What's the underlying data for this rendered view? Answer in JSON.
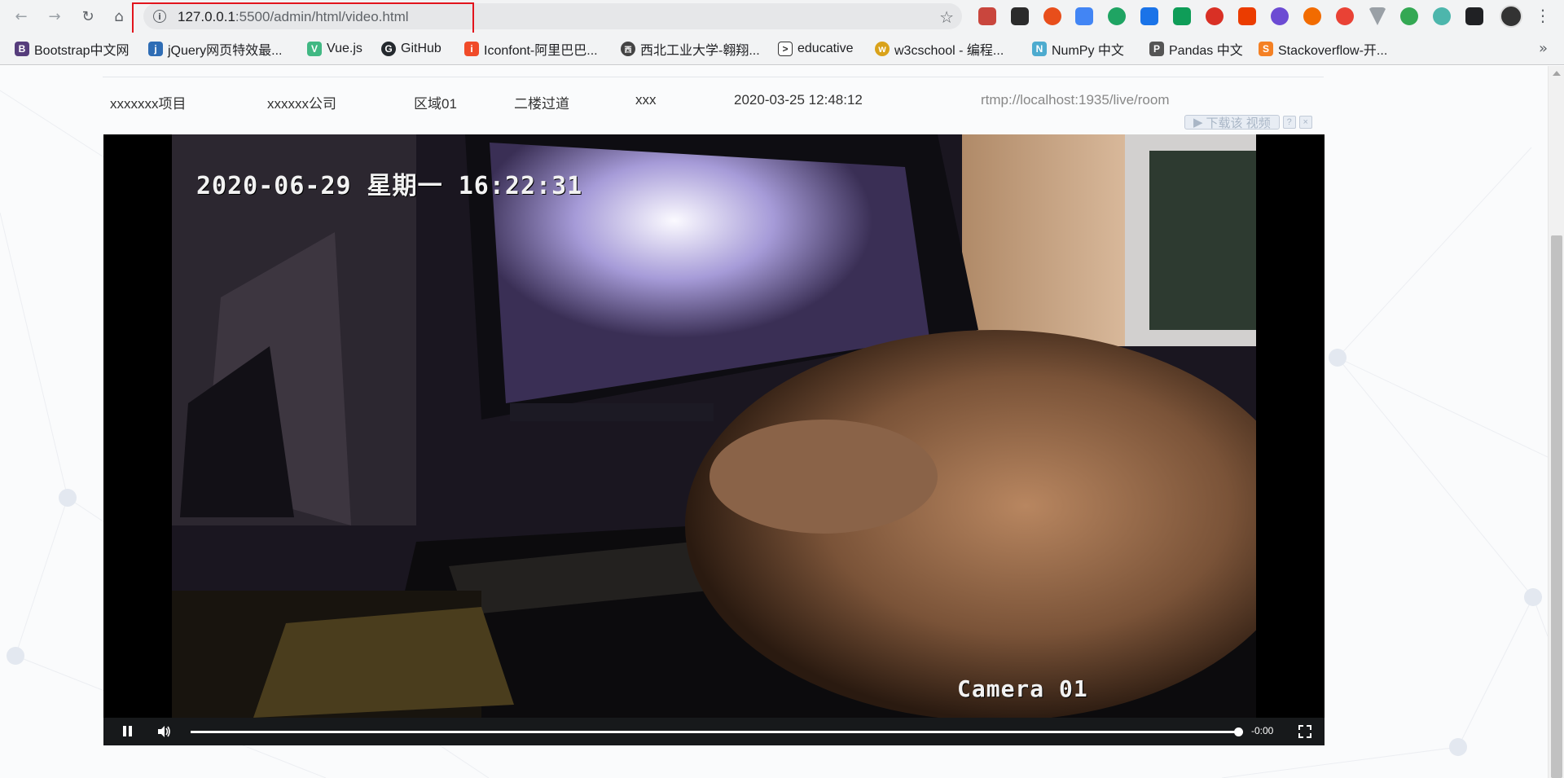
{
  "browser": {
    "url_host": "127.0.0.1",
    "url_path": ":5500/admin/html/video.html",
    "bookmarks": [
      {
        "label": "Bootstrap中文网",
        "icon": "bootstrap-icon",
        "color": "#563d7c",
        "glyph": "B"
      },
      {
        "label": "jQuery网页特效最...",
        "icon": "jquery-icon",
        "color": "#2f6db5",
        "glyph": "j"
      },
      {
        "label": "Vue.js",
        "icon": "vue-icon",
        "color": "#41b883",
        "glyph": "V"
      },
      {
        "label": "GitHub",
        "icon": "github-icon",
        "color": "#24292e",
        "glyph": "G"
      },
      {
        "label": "Iconfont-阿里巴巴...",
        "icon": "iconfont-icon",
        "color": "#f04b29",
        "glyph": "i"
      },
      {
        "label": "西北工业大学-翱翔...",
        "icon": "nwpu-icon",
        "color": "#444444",
        "glyph": "西"
      },
      {
        "label": "educative",
        "icon": "educative-icon",
        "color": "#333333",
        "glyph": ">"
      },
      {
        "label": "w3cschool - 编程...",
        "icon": "w3cschool-icon",
        "color": "#d9a21a",
        "glyph": "w"
      },
      {
        "label": "NumPy 中文",
        "icon": "numpy-icon",
        "color": "#4dabcf",
        "glyph": "N"
      },
      {
        "label": "Pandas 中文",
        "icon": "pandas-icon",
        "color": "#555555",
        "glyph": "P"
      },
      {
        "label": "Stackoverflow-开...",
        "icon": "stackoverflow-icon",
        "color": "#f48024",
        "glyph": "S"
      }
    ]
  },
  "row": {
    "project": "xxxxxxx项目",
    "company": "xxxxxx公司",
    "area": "区域01",
    "location": "二楼过道",
    "name": "xxx",
    "datetime": "2020-03-25 12:48:12",
    "stream_url": "rtmp://localhost:1935/live/room"
  },
  "download_bar": {
    "label": "下载该 视频",
    "help": "?",
    "close": "×"
  },
  "video": {
    "osd_datetime": "2020-06-29 星期一 16:22:31",
    "osd_camera": "Camera 01",
    "time_remaining": "-0:00",
    "progress": 1.0
  }
}
